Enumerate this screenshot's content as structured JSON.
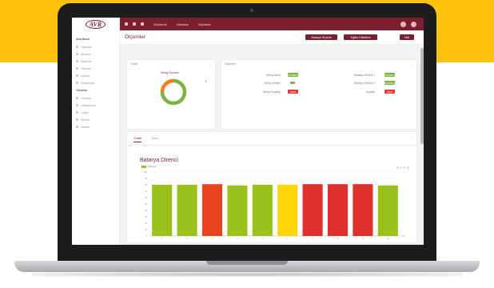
{
  "colors": {
    "brand": "#7b1f2e",
    "green_status": "#7cb342",
    "red_status": "#e53935",
    "bar_green": "#9bc21c",
    "bar_red": "#e0302d",
    "bar_orange": "#e8441f",
    "bar_yellow": "#ffd60a"
  },
  "topbar": {
    "logo": "AVR",
    "menu": [
      "Önizleme",
      "Alarmlar",
      "Ölçümler"
    ],
    "icons": [
      "menu-icon",
      "home-icon",
      "grid-icon"
    ]
  },
  "sidebar": {
    "sections": [
      {
        "title": "Ana Menü",
        "items": [
          {
            "label": "Ölçümler",
            "icon": "chart-icon"
          },
          {
            "label": "Alarmlar",
            "icon": "bell-icon"
          },
          {
            "label": "Raporlar",
            "icon": "file-icon"
          },
          {
            "label": "Cihazlar",
            "icon": "device-icon"
          },
          {
            "label": "Ayarlar",
            "icon": "gear-icon"
          },
          {
            "label": "Kullanıcılar",
            "icon": "user-icon"
          }
        ]
      },
      {
        "title": "Yönetim",
        "items": [
          {
            "label": "Firmalar",
            "icon": "building-icon"
          },
          {
            "label": "Lokasyonlar",
            "icon": "pin-icon"
          },
          {
            "label": "Loglar",
            "icon": "list-icon"
          },
          {
            "label": "Sistem",
            "icon": "server-icon"
          },
          {
            "label": "Destek",
            "icon": "help-icon"
          }
        ]
      }
    ]
  },
  "header": {
    "title": "Ölçümler",
    "buttons": [
      "Batarya Ölçümü",
      "Eğitim Fakültesi",
      "Hall"
    ]
  },
  "summary_card": {
    "title": "Grafik",
    "donut_label": "String Durumu"
  },
  "status_card": {
    "title": "Ölçümler",
    "rows": [
      {
        "label": "String Akımı",
        "badge": "NORMAL",
        "status": "green"
      },
      {
        "label": "String Gerilimi",
        "badge": "",
        "status": "green"
      },
      {
        "label": "String Sıcaklığı",
        "badge": "HATA",
        "status": "red"
      },
      {
        "label": "Batarya Gerilimi 1",
        "badge": "NORMAL",
        "status": "green"
      },
      {
        "label": "Batarya Gerilimi 2",
        "badge": "NORMAL",
        "status": "green"
      },
      {
        "label": "Sıcaklık",
        "badge": "HATA",
        "status": "red"
      }
    ]
  },
  "tabs": [
    "Grafik",
    "Tablo"
  ],
  "chart_data": {
    "type": "bar",
    "title": "Batarya Direnci",
    "series_name": "String 1",
    "categories": [
      "1",
      "2",
      "3",
      "4",
      "5",
      "6",
      "7",
      "8",
      "9",
      "10"
    ],
    "values": [
      80,
      80,
      81,
      79,
      80,
      80,
      81,
      81,
      81,
      79
    ],
    "bar_colors": [
      "#9bc21c",
      "#9bc21c",
      "#e8441f",
      "#9bc21c",
      "#9bc21c",
      "#ffd60a",
      "#e0302d",
      "#e0302d",
      "#e0302d",
      "#9bc21c"
    ],
    "y_ticks": [
      "0",
      "10",
      "20",
      "30",
      "40",
      "50",
      "60",
      "70",
      "80",
      "90",
      "100"
    ],
    "ylim": [
      0,
      100
    ],
    "xlabel": "No",
    "ylabel": ""
  }
}
